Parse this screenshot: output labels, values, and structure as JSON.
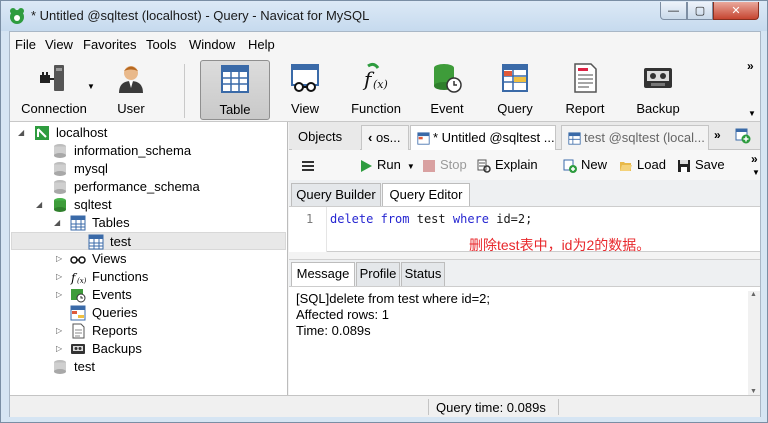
{
  "window": {
    "title": "* Untitled @sqltest (localhost) - Query - Navicat for MySQL",
    "min": "—",
    "max": "▢",
    "close": "✕"
  },
  "menu": [
    "File",
    "View",
    "Favorites",
    "Tools",
    "Window",
    "Help"
  ],
  "toolbar": {
    "connection": "Connection",
    "user": "User",
    "table": "Table",
    "view": "View",
    "function": "Function",
    "event": "Event",
    "query": "Query",
    "report": "Report",
    "backup": "Backup",
    "more": "»"
  },
  "tree": {
    "connection": "localhost",
    "dbs": [
      "information_schema",
      "mysql",
      "performance_schema",
      "sqltest"
    ],
    "tables_label": "Tables",
    "table_item": "test",
    "views": "Views",
    "functions": "Functions",
    "events": "Events",
    "queries": "Queries",
    "reports": "Reports",
    "backups": "Backups",
    "db_test": "test"
  },
  "tabs": {
    "objects": "Objects",
    "prev_tab": "os...",
    "active": "* Untitled @sqltest ...",
    "next_tab": "test @sqltest (local...",
    "more": "»"
  },
  "query_toolbar": {
    "run": "Run",
    "stop": "Stop",
    "explain": "Explain",
    "new": "New",
    "load": "Load",
    "save": "Save",
    "more": "»"
  },
  "subtabs": {
    "builder": "Query Builder",
    "editor": "Query Editor"
  },
  "editor": {
    "line_no": "1",
    "kw1": "delete",
    "kw2": "from",
    "ident": "test",
    "kw3": "where",
    "rest": "id=2;",
    "note": "删除test表中，id为2的数据。"
  },
  "msg_tabs": {
    "message": "Message",
    "profile": "Profile",
    "status": "Status"
  },
  "messages": [
    "[SQL]delete from test where id=2;",
    "Affected rows: 1",
    "Time: 0.089s"
  ],
  "status_bar": {
    "query_time": "Query time: 0.089s"
  }
}
